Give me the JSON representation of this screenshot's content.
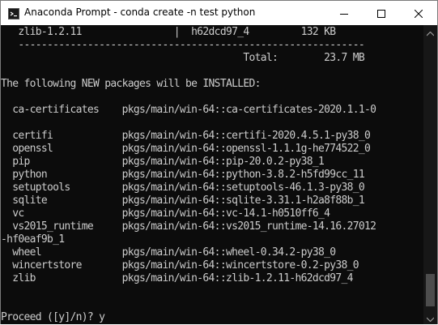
{
  "window": {
    "title": "Anaconda Prompt - conda  create -n test python"
  },
  "icons": {
    "app": "terminal-icon",
    "minimize": "minimize-icon",
    "maximize": "maximize-icon",
    "close": "close-icon"
  },
  "colors": {
    "console_bg": "#0c0c0c",
    "console_text": "#cccccc"
  },
  "console": {
    "lines": [
      "   zlib-1.2.11                |  h62dcd97_4         132 KB",
      "   ------------------------------------------------------------",
      "                                          Total:        23.7 MB",
      "",
      "The following NEW packages will be INSTALLED:",
      "",
      "  ca-certificates    pkgs/main/win-64::ca-certificates-2020.1.1-0",
      "",
      "  certifi            pkgs/main/win-64::certifi-2020.4.5.1-py38_0",
      "  openssl            pkgs/main/win-64::openssl-1.1.1g-he774522_0",
      "  pip                pkgs/main/win-64::pip-20.0.2-py38_1",
      "  python             pkgs/main/win-64::python-3.8.2-h5fd99cc_11",
      "  setuptools         pkgs/main/win-64::setuptools-46.1.3-py38_0",
      "  sqlite             pkgs/main/win-64::sqlite-3.31.1-h2a8f88b_1",
      "  vc                 pkgs/main/win-64::vc-14.1-h0510ff6_4",
      "  vs2015_runtime     pkgs/main/win-64::vs2015_runtime-14.16.27012",
      "-hf0eaf9b_1",
      "  wheel              pkgs/main/win-64::wheel-0.34.2-py38_0",
      "  wincertstore       pkgs/main/win-64::wincertstore-0.2-py38_0",
      "  zlib               pkgs/main/win-64::zlib-1.2.11-h62dcd97_4",
      "",
      "",
      "Proceed ([y]/n)? y"
    ]
  }
}
